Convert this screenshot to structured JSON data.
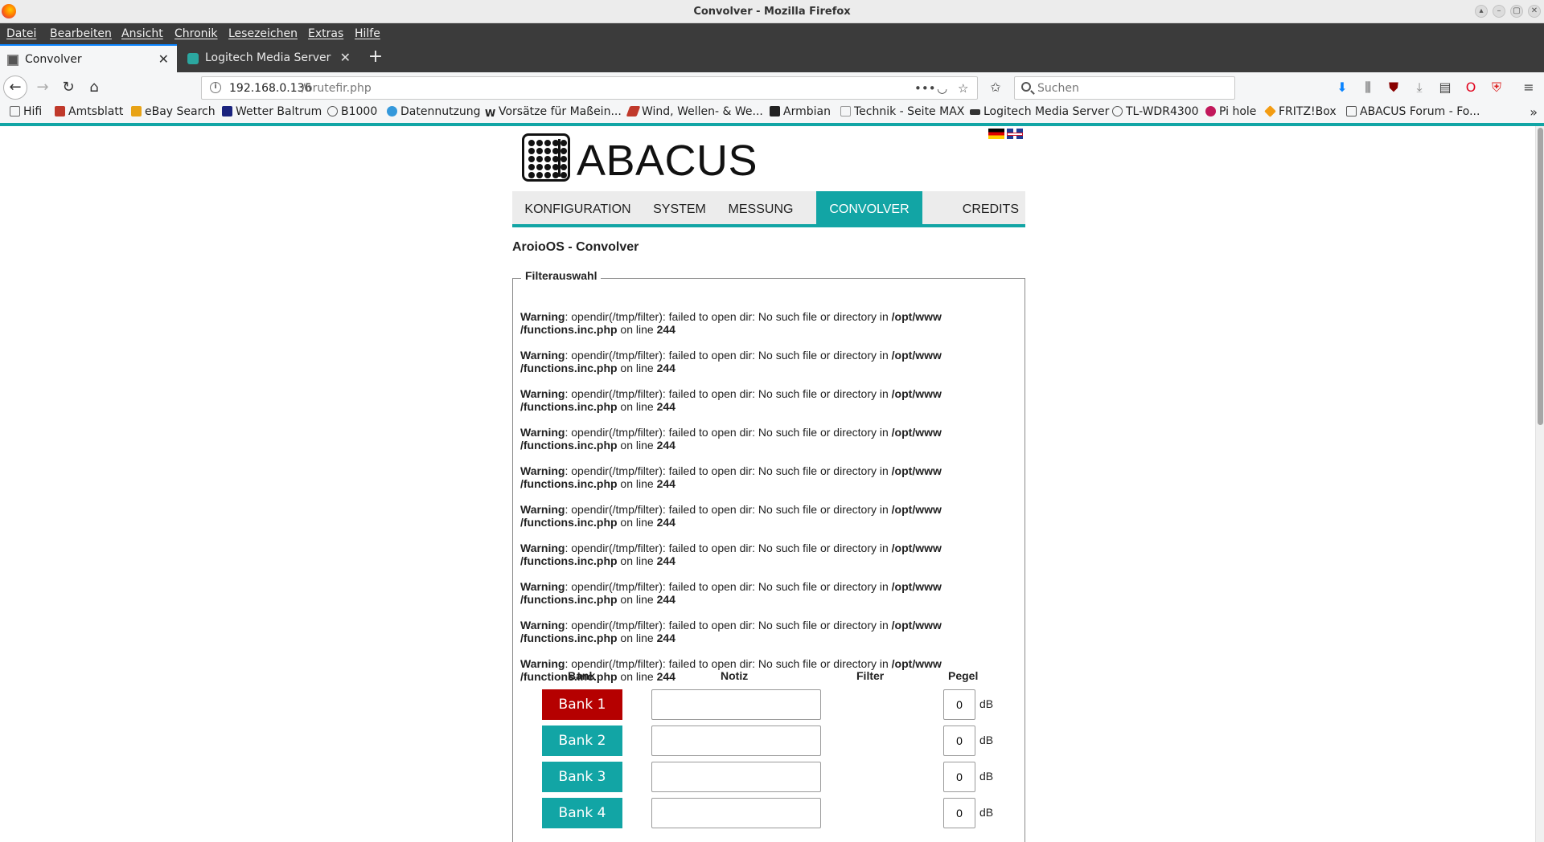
{
  "window": {
    "title": "Convolver - Mozilla Firefox"
  },
  "menu": [
    "Datei",
    "Bearbeiten",
    "Ansicht",
    "Chronik",
    "Lesezeichen",
    "Extras",
    "Hilfe"
  ],
  "tabs": [
    {
      "label": "Convolver",
      "active": true
    },
    {
      "label": "Logitech Media Server",
      "active": false
    }
  ],
  "urlbar": {
    "host": "192.168.0.136",
    "path": "/brutefir.php"
  },
  "search": {
    "placeholder": "Suchen"
  },
  "bookmarks": [
    "Hifi",
    "Amtsblatt",
    "eBay Search",
    "Wetter Baltrum",
    "B1000",
    "Datennutzung",
    "Vorsätze für Maßein...",
    "Wind, Wellen- & We...",
    "Armbian",
    "Technik - Seite MAX",
    "Logitech Media Server",
    "TL-WDR4300",
    "Pi hole",
    "FRITZ!Box",
    "ABACUS Forum - Fo..."
  ],
  "page": {
    "logo_text": "ABACUS",
    "nav": [
      "KONFIGURATION",
      "SYSTEM",
      "MESSUNG",
      "CONVOLVER",
      "CREDITS"
    ],
    "active_nav": "CONVOLVER",
    "title": "AroioOS - Convolver",
    "fieldset_legend": "Filterauswahl",
    "warning": {
      "label": "Warning",
      "message": ": opendir(/tmp/filter): failed to open dir: No such file or directory in ",
      "path1": "/opt/www",
      "path2": "/functions.inc.php",
      "on_line": " on line ",
      "line": "244",
      "count": 10
    },
    "table": {
      "headers": {
        "bank": "Bank",
        "note": "Notiz",
        "filter": "Filter",
        "pegel": "Pegel"
      },
      "unit": "dB",
      "rows": [
        {
          "bank": "Bank 1",
          "note": "",
          "pegel": "0",
          "active": true
        },
        {
          "bank": "Bank 2",
          "note": "",
          "pegel": "0",
          "active": false
        },
        {
          "bank": "Bank 3",
          "note": "",
          "pegel": "0",
          "active": false
        },
        {
          "bank": "Bank 4",
          "note": "",
          "pegel": "0",
          "active": false
        }
      ]
    }
  },
  "colors": {
    "accent": "#12a5a5",
    "bank_active": "#b50000",
    "bank_inactive": "#12a5a5"
  }
}
